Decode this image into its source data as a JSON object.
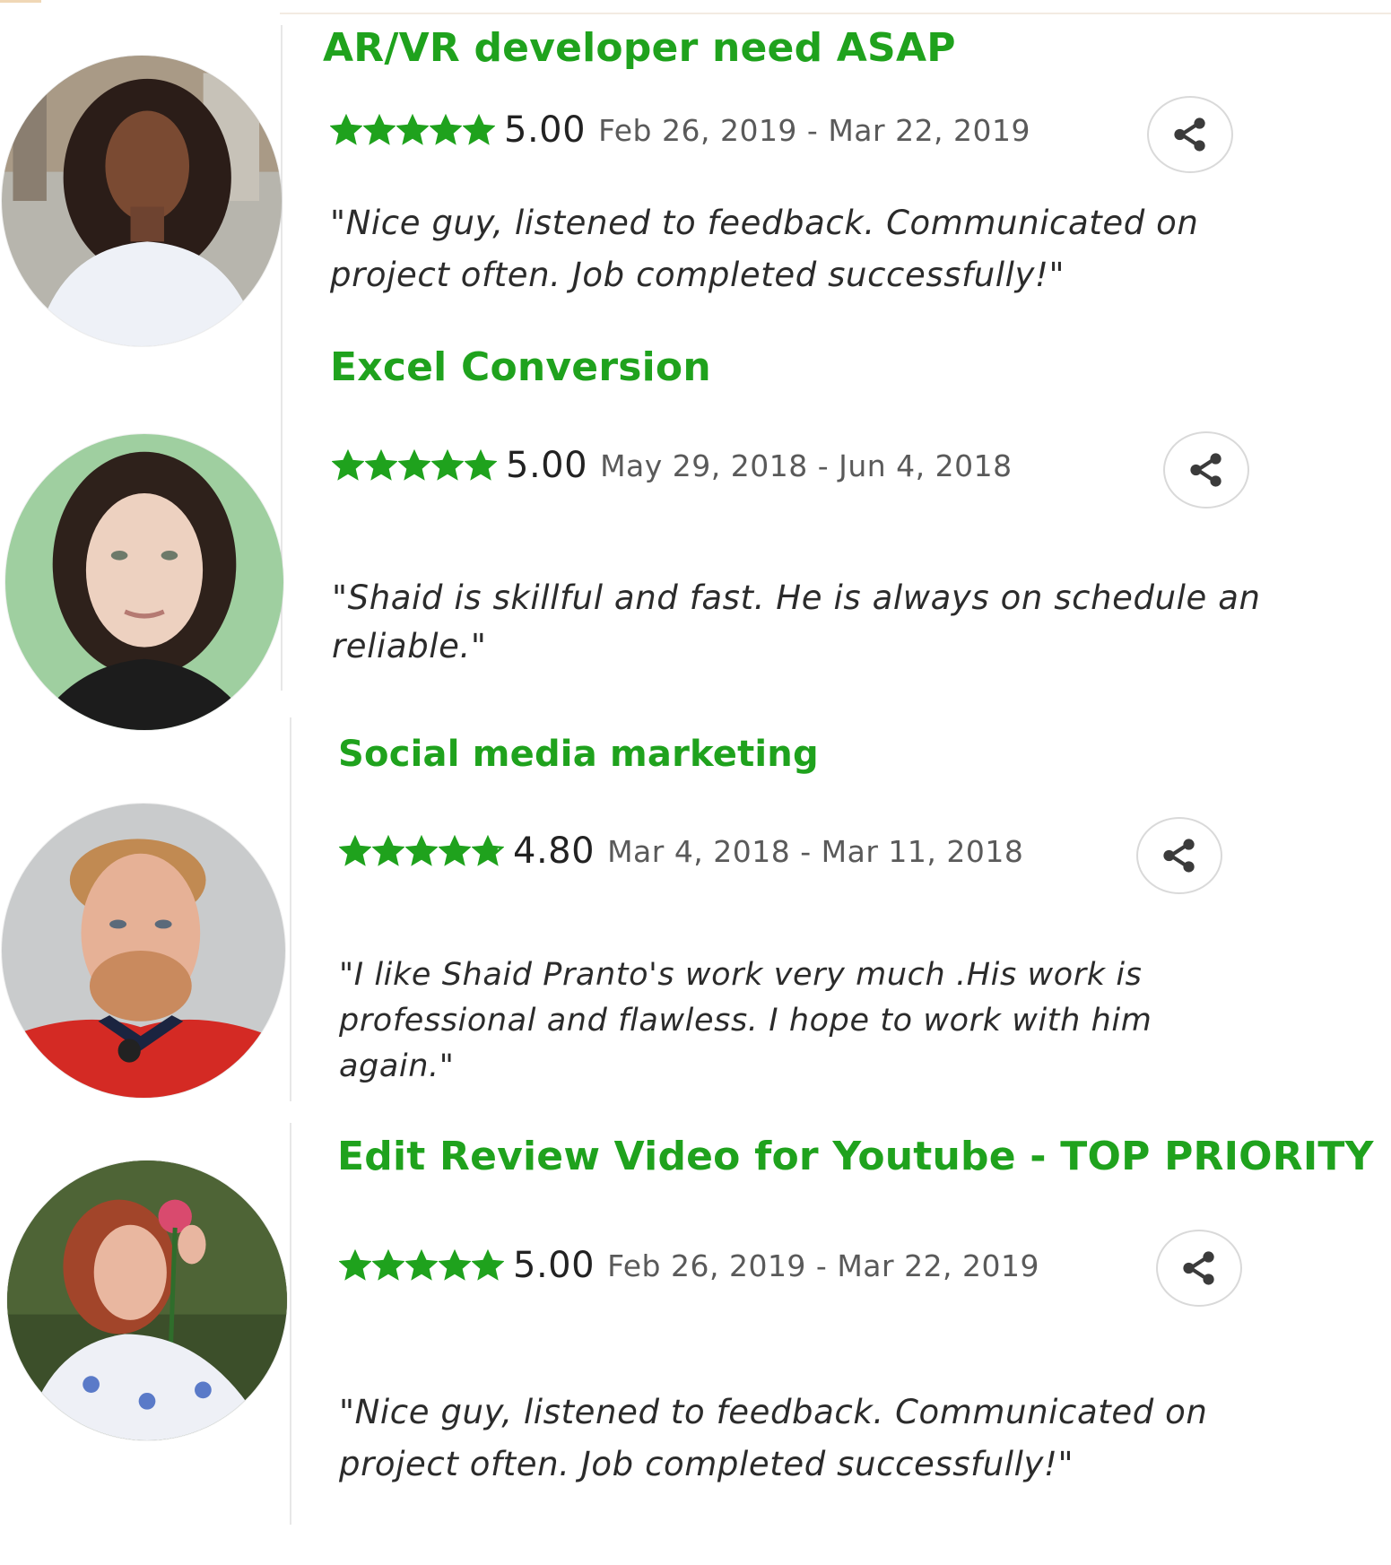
{
  "reviews": [
    {
      "title": "AR/VR developer need ASAP",
      "score": "5.00",
      "dates": "Feb 26, 2019 - Mar 22, 2019",
      "stars": 5,
      "review_lines": [
        "\"Nice guy, listened to feedback. Communicated on",
        "project often. Job completed successfully!\""
      ],
      "avatar": "reviewer-photo"
    },
    {
      "title": "Excel Conversion",
      "score": "5.00",
      "dates": "May 29, 2018 - Jun 4, 2018",
      "stars": 5,
      "review_lines": [
        "\"Shaid is skillful and fast. He is always on schedule an",
        "reliable.\""
      ],
      "avatar": "reviewer-photo"
    },
    {
      "title": "Social media marketing",
      "score": "4.80",
      "dates": "Mar 4, 2018 - Mar 11, 2018",
      "stars": 4.8,
      "review_lines": [
        "\"I like Shaid Pranto's work very much .His work is",
        "professional and flawless. I hope to work with him",
        "again.\""
      ],
      "avatar": "reviewer-photo"
    },
    {
      "title": "Edit Review Video for Youtube - TOP PRIORITY",
      "score": "5.00",
      "dates": "Feb 26, 2019 - Mar 22, 2019",
      "stars": 5,
      "review_lines": [
        "\"Nice guy, listened to feedback. Communicated on",
        "project often. Job completed successfully!\""
      ],
      "avatar": "reviewer-photo"
    }
  ],
  "icons": {
    "star": "star-icon",
    "share": "share-icon"
  },
  "colors": {
    "accent": "#1fa21d",
    "text": "#2b2b2b",
    "muted": "#5a5a5a",
    "border": "#d9d9d9"
  }
}
